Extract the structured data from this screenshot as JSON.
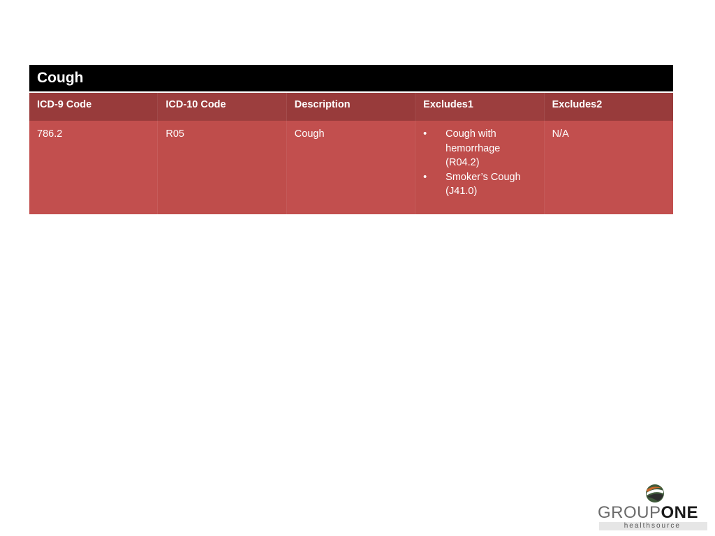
{
  "table": {
    "title": "Cough",
    "headers": [
      "ICD-9 Code",
      "ICD-10 Code",
      "Description",
      "Excludes1",
      "Excludes2"
    ],
    "row": {
      "icd9": "786.2",
      "icd10": "R05",
      "description": "Cough",
      "excludes1": [
        {
          "bullet": "•",
          "text": "Cough with hemorrhage (R04.2)"
        },
        {
          "bullet": "•",
          "text": "Smoker’s Cough (J41.0)"
        }
      ],
      "excludes2": "N/A"
    }
  },
  "logo": {
    "word_part1": "GROUP",
    "word_part2": "ONE",
    "tagline": "healthsource"
  },
  "colors": {
    "title_bg": "#000000",
    "header_bg": "#983c3c",
    "row_bg": "#c0504d",
    "logo_orange": "#c8682a",
    "logo_green": "#3f5a3a"
  }
}
